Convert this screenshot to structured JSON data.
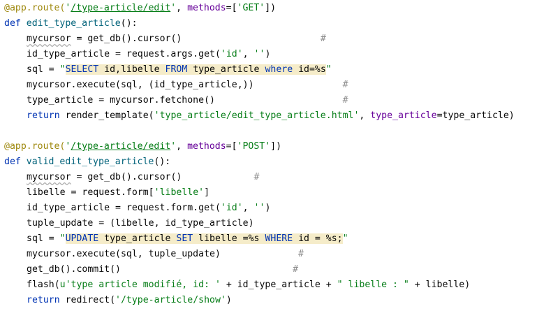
{
  "colors": {
    "background": "#ffffff",
    "decorator": "#9e880d",
    "keyword": "#0033b3",
    "string": "#067d17",
    "function_name": "#00627a",
    "keyword_argument": "#660099",
    "comment": "#8c8c8c",
    "sql_highlight_background": "#f5ecc9"
  },
  "code_lines": [
    {
      "indent": 0,
      "tokens": [
        {
          "t": "@app.route(",
          "c": "dec"
        },
        {
          "t": "'",
          "c": "str"
        },
        {
          "t": "/type-article/edit",
          "c": "url"
        },
        {
          "t": "'",
          "c": "str"
        },
        {
          "t": ", ",
          "c": "tx"
        },
        {
          "t": "methods",
          "c": "arg"
        },
        {
          "t": "=[",
          "c": "tx"
        },
        {
          "t": "'GET'",
          "c": "str"
        },
        {
          "t": "])",
          "c": "tx"
        }
      ]
    },
    {
      "indent": 0,
      "tokens": [
        {
          "t": "def ",
          "c": "kw"
        },
        {
          "t": "edit_type_article",
          "c": "fn"
        },
        {
          "t": "():",
          "c": "tx"
        }
      ]
    },
    {
      "indent": 4,
      "tokens": [
        {
          "t": "mycursor",
          "c": "tx",
          "w": true
        },
        {
          "t": " = get_db().cursor()",
          "c": "tx"
        },
        {
          "t": "                         #",
          "c": "com"
        }
      ]
    },
    {
      "indent": 4,
      "tokens": [
        {
          "t": "id_type_article = request.args.get(",
          "c": "tx"
        },
        {
          "t": "'id'",
          "c": "str"
        },
        {
          "t": ", ",
          "c": "tx"
        },
        {
          "t": "''",
          "c": "str"
        },
        {
          "t": ")",
          "c": "tx"
        }
      ]
    },
    {
      "indent": 4,
      "tokens": [
        {
          "t": "sql = ",
          "c": "tx"
        },
        {
          "t": "\"",
          "c": "str"
        },
        {
          "t": "SELECT",
          "c": "sql",
          "h": true
        },
        {
          "t": " id,libelle ",
          "c": "tx",
          "h": true
        },
        {
          "t": "FROM",
          "c": "sql",
          "h": true
        },
        {
          "t": " type_article ",
          "c": "tx",
          "h": true
        },
        {
          "t": "where",
          "c": "sql",
          "h": true
        },
        {
          "t": " id=%s",
          "c": "tx",
          "h": true
        },
        {
          "t": "\"",
          "c": "str"
        }
      ]
    },
    {
      "indent": 4,
      "tokens": [
        {
          "t": "mycursor.execute(sql, (id_type_article,))",
          "c": "tx"
        },
        {
          "t": "                #",
          "c": "com"
        }
      ]
    },
    {
      "indent": 4,
      "tokens": [
        {
          "t": "type_article = mycursor.fetchone()",
          "c": "tx"
        },
        {
          "t": "                       #",
          "c": "com"
        }
      ]
    },
    {
      "indent": 4,
      "tokens": [
        {
          "t": "return ",
          "c": "kw"
        },
        {
          "t": "render_template(",
          "c": "tx"
        },
        {
          "t": "'type_article/edit_type_article.html'",
          "c": "str"
        },
        {
          "t": ", ",
          "c": "tx"
        },
        {
          "t": "type_article",
          "c": "arg"
        },
        {
          "t": "=type_article)",
          "c": "tx"
        }
      ]
    },
    {
      "indent": 0,
      "tokens": []
    },
    {
      "indent": 0,
      "tokens": [
        {
          "t": "@app.route(",
          "c": "dec"
        },
        {
          "t": "'",
          "c": "str"
        },
        {
          "t": "/type-article/edit",
          "c": "url"
        },
        {
          "t": "'",
          "c": "str"
        },
        {
          "t": ", ",
          "c": "tx"
        },
        {
          "t": "methods",
          "c": "arg"
        },
        {
          "t": "=[",
          "c": "tx"
        },
        {
          "t": "'POST'",
          "c": "str"
        },
        {
          "t": "])",
          "c": "tx"
        }
      ]
    },
    {
      "indent": 0,
      "tokens": [
        {
          "t": "def ",
          "c": "kw"
        },
        {
          "t": "valid_edit_type_article",
          "c": "fn"
        },
        {
          "t": "():",
          "c": "tx"
        }
      ]
    },
    {
      "indent": 4,
      "tokens": [
        {
          "t": "mycursor",
          "c": "tx",
          "w": true
        },
        {
          "t": " = get_db().cursor()",
          "c": "tx"
        },
        {
          "t": "             #",
          "c": "com"
        }
      ]
    },
    {
      "indent": 4,
      "tokens": [
        {
          "t": "libelle = request.form[",
          "c": "tx"
        },
        {
          "t": "'libelle'",
          "c": "str"
        },
        {
          "t": "]",
          "c": "tx"
        }
      ]
    },
    {
      "indent": 4,
      "tokens": [
        {
          "t": "id_type_article = request.form.get(",
          "c": "tx"
        },
        {
          "t": "'id'",
          "c": "str"
        },
        {
          "t": ", ",
          "c": "tx"
        },
        {
          "t": "''",
          "c": "str"
        },
        {
          "t": ")",
          "c": "tx"
        }
      ]
    },
    {
      "indent": 4,
      "tokens": [
        {
          "t": "tuple_update = (libelle, id_type_article)",
          "c": "tx"
        }
      ]
    },
    {
      "indent": 4,
      "tokens": [
        {
          "t": "sql = ",
          "c": "tx"
        },
        {
          "t": "\"",
          "c": "str"
        },
        {
          "t": "UPDATE",
          "c": "sql",
          "h": true
        },
        {
          "t": " type_article ",
          "c": "tx",
          "h": true
        },
        {
          "t": "SET",
          "c": "sql",
          "h": true
        },
        {
          "t": " libelle =%s ",
          "c": "tx",
          "h": true
        },
        {
          "t": "WHERE",
          "c": "sql",
          "h": true
        },
        {
          "t": " id = %s;",
          "c": "tx",
          "h": true
        },
        {
          "t": "\"",
          "c": "str"
        }
      ]
    },
    {
      "indent": 4,
      "tokens": [
        {
          "t": "mycursor.execute(sql, tuple_update)",
          "c": "tx"
        },
        {
          "t": "              #",
          "c": "com"
        }
      ]
    },
    {
      "indent": 4,
      "tokens": [
        {
          "t": "get_db().commit()",
          "c": "tx"
        },
        {
          "t": "                               #",
          "c": "com"
        }
      ]
    },
    {
      "indent": 4,
      "tokens": [
        {
          "t": "flash(",
          "c": "tx"
        },
        {
          "t": "u'type article modifié, id: '",
          "c": "str"
        },
        {
          "t": " + id_type_article + ",
          "c": "tx"
        },
        {
          "t": "\" libelle : \"",
          "c": "str"
        },
        {
          "t": " + libelle)",
          "c": "tx"
        }
      ]
    },
    {
      "indent": 4,
      "tokens": [
        {
          "t": "return ",
          "c": "kw"
        },
        {
          "t": "redirect(",
          "c": "tx"
        },
        {
          "t": "'/type-article/show'",
          "c": "str"
        },
        {
          "t": ")",
          "c": "tx"
        }
      ]
    }
  ]
}
